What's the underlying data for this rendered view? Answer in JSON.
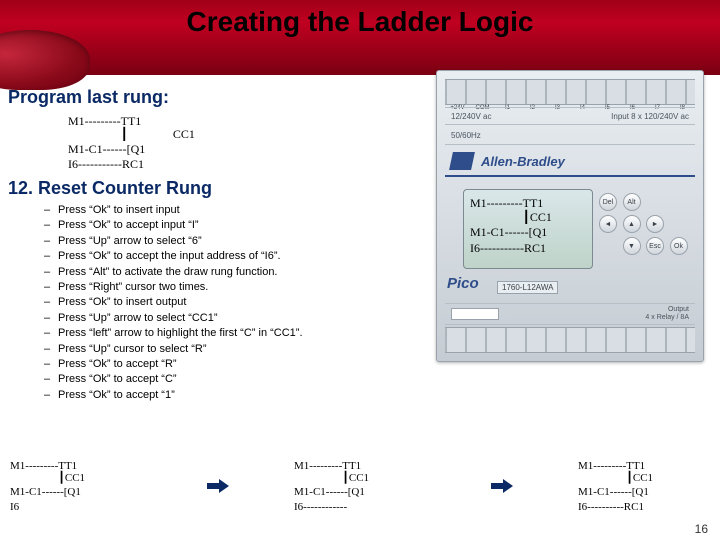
{
  "title": "Creating the Ladder Logic",
  "subtitle1": "Program last rung:",
  "subtitle2": "12. Reset Counter Rung",
  "ladder_main": {
    "l1": "M1---------TT1",
    "l2": "               CC1",
    "l3": "M1-C1------[Q1",
    "l4": "I6-----------RC1"
  },
  "steps": [
    "Press “Ok” to insert input",
    "Press “Ok” to accept input “I”",
    "Press “Up” arrow to select “6”",
    "Press “Ok” to accept the input address of “I6”.",
    "Press “Alt” to activate the draw rung function.",
    "Press “Right” cursor two times.",
    "Press “Ok” to insert output",
    "Press “Up” arrow to select “CC1”",
    "Press “left” arrow to highlight the first “C” in “CC1”.",
    "Press “Up” cursor to select “R”",
    "Press “Ok” to accept “R”",
    "Press “Ok” to accept “C”",
    "Press “Ok” to accept “1”"
  ],
  "lcd": {
    "l1": "M1---------TT1",
    "l2": "               CC1",
    "l3": "M1-C1------[Q1",
    "l4": "I6-----------RC1"
  },
  "brand": "Allen-Bradley",
  "pico": "Pico",
  "model": "1760-L12AWA",
  "info_left1": "12/240V ac",
  "info_right1": "Input 8 x 120/240V ac",
  "info_left2": "50/60Hz",
  "keys": [
    "Del",
    "Alt",
    "",
    "",
    "◄",
    "▲",
    "►",
    "",
    "",
    "▼",
    "Esc",
    "Ok"
  ],
  "out_text": "Output\n4 x Relay / 8A",
  "term_top": [
    "+24V",
    "COM",
    "I1",
    "I2",
    "I3",
    "I4",
    "I5",
    "I6",
    "I7",
    "I8"
  ],
  "bottom_blocks": [
    {
      "l1": "M1---------TT1",
      "l2": "               CC1",
      "l3": "M1-C1------[Q1",
      "l4": "I6"
    },
    {
      "l1": "M1---------TT1",
      "l2": "               CC1",
      "l3": "M1-C1------[Q1",
      "l4": "I6------------"
    },
    {
      "l1": "M1---------TT1",
      "l2": "               CC1",
      "l3": "M1-C1------[Q1",
      "l4": "I6----------RC1"
    }
  ],
  "page": "16"
}
